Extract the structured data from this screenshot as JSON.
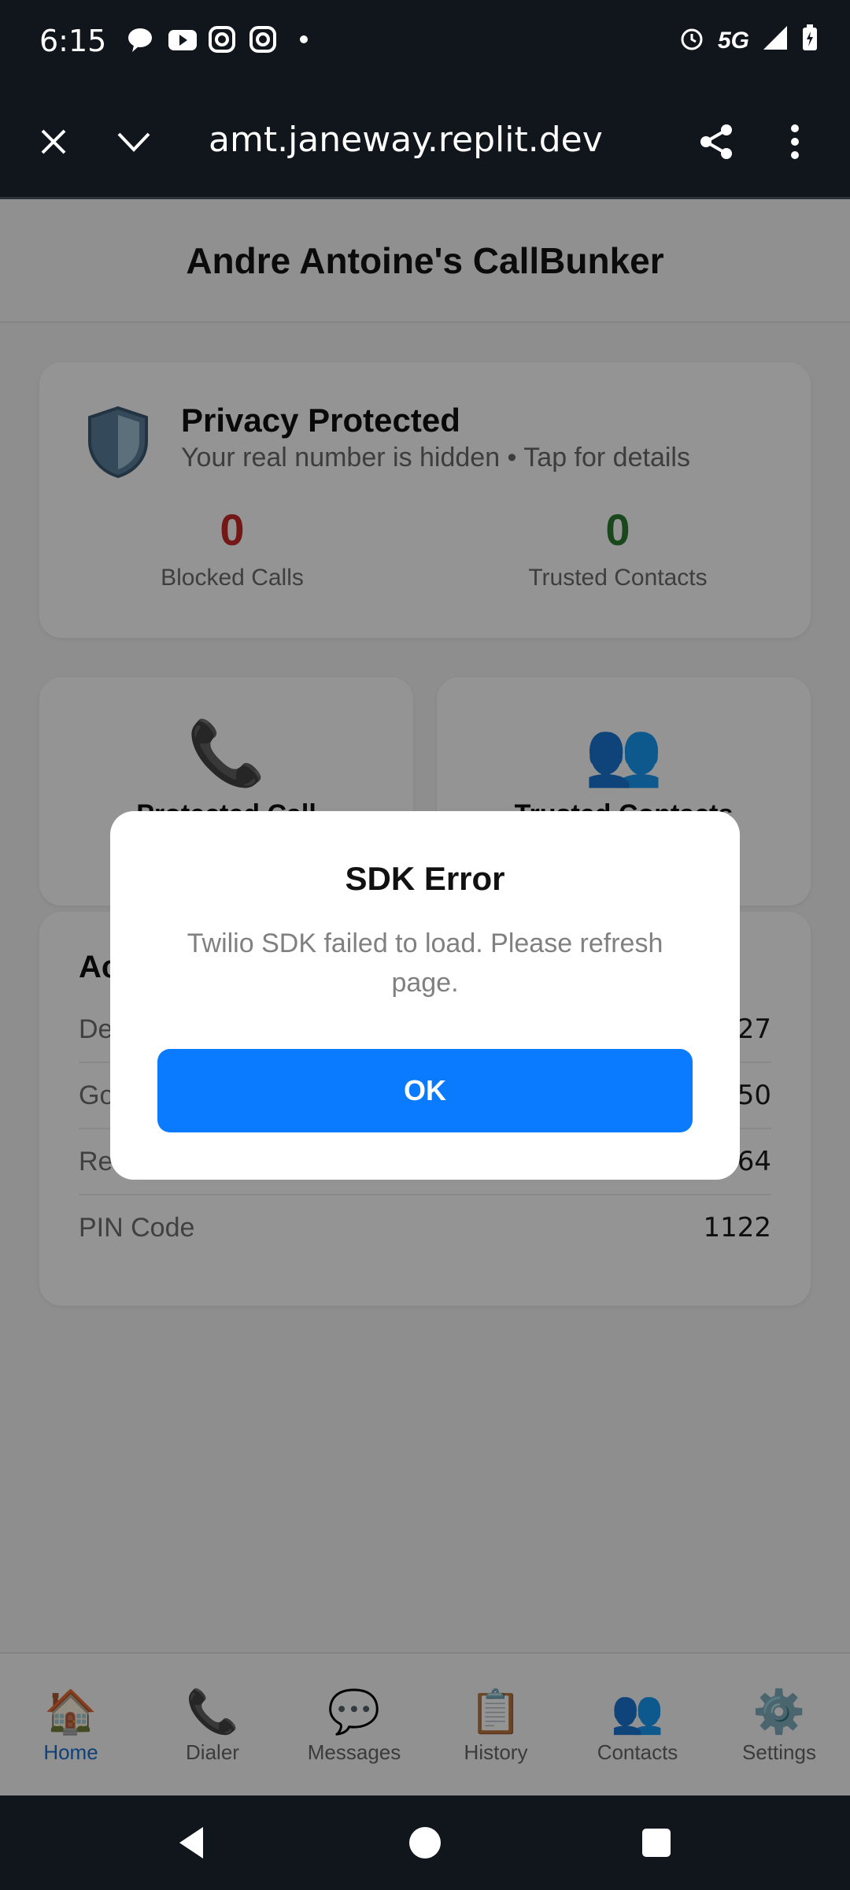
{
  "status_bar": {
    "time": "6:15",
    "network": "5G"
  },
  "browser": {
    "url": "amt.janeway.replit.dev"
  },
  "app": {
    "title": "Andre Antoine's CallBunker"
  },
  "privacy": {
    "title": "Privacy Protected",
    "subtitle": "Your real number is hidden • Tap for details",
    "blocked_value": "0",
    "blocked_label": "Blocked Calls",
    "trusted_value": "0",
    "trusted_label": "Trusted Contacts"
  },
  "actions": [
    {
      "label": "Protected Call",
      "icon": "phone-icon"
    },
    {
      "label": "Trusted Contacts",
      "icon": "people-icon"
    }
  ],
  "account": {
    "title": "Ac",
    "rows": [
      {
        "key": "De",
        "value": "27"
      },
      {
        "key": "Go",
        "value": "50"
      },
      {
        "key": "Re",
        "value": "64"
      },
      {
        "key": "PIN Code",
        "value": "1122"
      }
    ]
  },
  "nav": [
    {
      "label": "Home",
      "icon": "home-icon"
    },
    {
      "label": "Dialer",
      "icon": "phone-icon"
    },
    {
      "label": "Messages",
      "icon": "chat-icon"
    },
    {
      "label": "History",
      "icon": "clipboard-icon"
    },
    {
      "label": "Contacts",
      "icon": "people-icon"
    },
    {
      "label": "Settings",
      "icon": "gear-icon"
    }
  ],
  "dialog": {
    "title": "SDK Error",
    "message": "Twilio SDK failed to load. Please refresh page.",
    "ok_label": "OK"
  },
  "colors": {
    "accent": "#0a7bff",
    "blocked": "#c62828",
    "trusted": "#2e7d32"
  }
}
